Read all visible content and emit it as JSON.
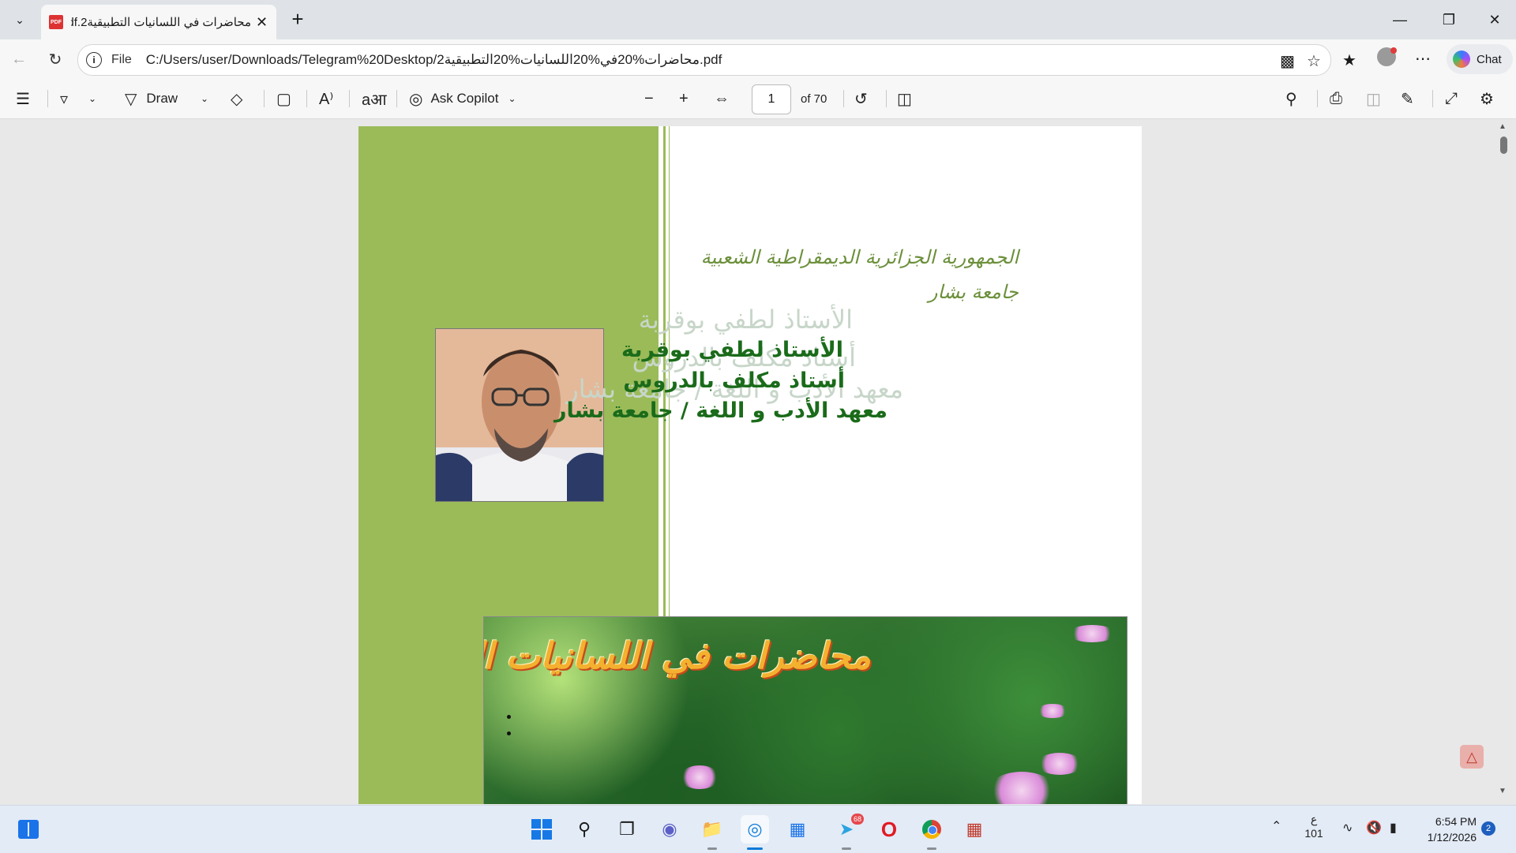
{
  "browser": {
    "tab_title": "محاضرات في اللسانيات التطبيقية2.pdf",
    "pdf_icon_label": "PDF",
    "address_scheme": "File",
    "address_url": "C:/Users/user/Downloads/Telegram%20Desktop/محاضرات%20في%20اللسانيات%20التطبيقية2.pdf",
    "chat_label": "Chat"
  },
  "pdf_toolbar": {
    "draw_label": "Draw",
    "ask_copilot_label": "Ask Copilot",
    "page_current": "1",
    "page_total": "of 70"
  },
  "document": {
    "header_line1": "الجمهورية الجزائرية الديمقراطية الشعبية",
    "header_line2": "جامعة بشار",
    "shadow_line1": "الأستاذ  لطفي  بوقربة",
    "shadow_line2": "أستاذ مكلف بالدروس",
    "shadow_line3": "معهد الأدب و اللغة / جامعة بشار",
    "author_name": "الأستاذ لطفي بوقربة",
    "author_rank": "أستاذ مكلف بالدروس",
    "author_institute": "معهد  الأدب و اللغة / جامعة بشار",
    "banner_title": "محاضرات في اللسانيات التطبيقية"
  },
  "taskbar": {
    "telegram_badge": "68",
    "language_line1": "ع",
    "language_line2": "101",
    "time": "6:54 PM",
    "date": "1/12/2026",
    "notification_count": "2"
  },
  "colors": {
    "green_sidebar": "#9bbb59",
    "header_green": "#6b8f3a",
    "author_green": "#1a6b1a",
    "banner_title_orange": "#f3b12f"
  }
}
